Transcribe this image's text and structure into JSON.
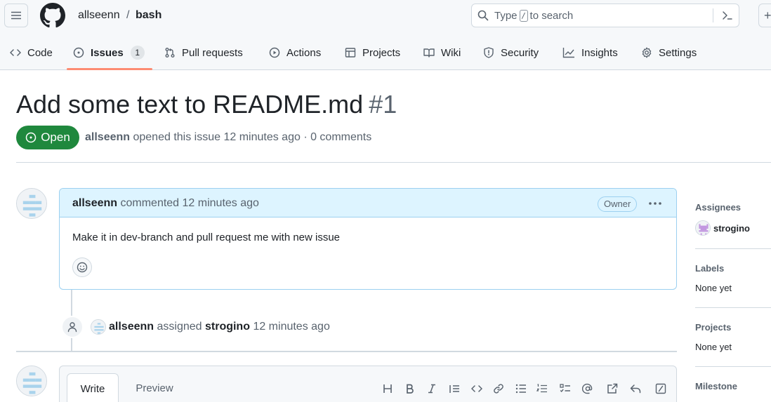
{
  "header": {
    "owner": "allseenn",
    "separator": "/",
    "repo": "bash",
    "search": {
      "prefix": "Type",
      "slash": "/",
      "suffix": "to search"
    },
    "plus": "+"
  },
  "tabs": [
    {
      "label": "Code",
      "icon": "code-icon"
    },
    {
      "label": "Issues",
      "icon": "issue-opened-icon",
      "counter": "1",
      "active": true
    },
    {
      "label": "Pull requests",
      "icon": "git-pull-request-icon"
    },
    {
      "label": "Actions",
      "icon": "play-icon"
    },
    {
      "label": "Projects",
      "icon": "table-icon"
    },
    {
      "label": "Wiki",
      "icon": "book-icon"
    },
    {
      "label": "Security",
      "icon": "shield-icon"
    },
    {
      "label": "Insights",
      "icon": "graph-icon"
    },
    {
      "label": "Settings",
      "icon": "gear-icon"
    }
  ],
  "issue": {
    "title": "Add some text to README.md",
    "number": "#1",
    "state": "Open",
    "author": "allseenn",
    "meta_rest": "opened this issue 12 minutes ago · 0 comments"
  },
  "comment": {
    "author": "allseenn",
    "action": "commented 12 minutes ago",
    "badge": "Owner",
    "body": "Make it in dev-branch and pull request me with new issue"
  },
  "event": {
    "actor": "allseenn",
    "verb": "assigned",
    "target": "strogino",
    "time": "12 minutes ago"
  },
  "form": {
    "write_tab": "Write",
    "preview_tab": "Preview",
    "toolbar": [
      "heading",
      "bold",
      "italic",
      "quote",
      "code",
      "link",
      "unordered-list",
      "ordered-list",
      "task-list",
      "mention",
      "cross-reference",
      "reply",
      "slash-command"
    ]
  },
  "sidebar": {
    "assignees_heading": "Assignees",
    "assignee": "strogino",
    "labels_heading": "Labels",
    "labels_value": "None yet",
    "projects_heading": "Projects",
    "projects_value": "None yet",
    "milestone_heading": "Milestone"
  },
  "colors": {
    "open_green": "#1f883d",
    "tab_underline": "#fd8c73",
    "comment_header_bg": "#ddf4ff",
    "comment_border": "#9cd0f0"
  }
}
